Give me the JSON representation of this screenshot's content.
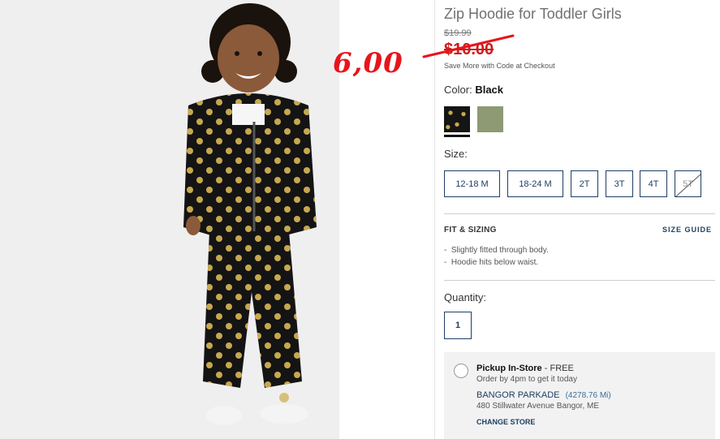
{
  "product": {
    "title": "Zip Hoodie for Toddler Girls",
    "price_was": "$19.99",
    "price_now": "$10.00",
    "promo_note": "Save More with Code at Checkout",
    "handwritten_price": "6,00"
  },
  "color": {
    "label": "Color:",
    "selected": "Black",
    "swatches": [
      {
        "name": "Black polka dot",
        "hex": "#151515"
      },
      {
        "name": "Olive",
        "hex": "#8d9a73"
      }
    ]
  },
  "size": {
    "label": "Size:",
    "options": [
      "12-18 M",
      "18-24 M",
      "2T",
      "3T",
      "4T",
      "5T"
    ],
    "unavailable": [
      "5T"
    ]
  },
  "fit": {
    "title": "FIT & SIZING",
    "guide_link": "SIZE GUIDE",
    "bullets": [
      "Slightly fitted through body.",
      "Hoodie hits below waist."
    ]
  },
  "quantity": {
    "label": "Quantity:",
    "value": "1"
  },
  "pickup": {
    "title": "Pickup In-Store",
    "fee": "- FREE",
    "subtitle": "Order by 4pm to get it today",
    "store_name": "BANGOR PARKADE",
    "store_distance": "(4278.76 Mi)",
    "store_address": "480 Stillwater Avenue Bangor, ME",
    "change_store": "CHANGE STORE"
  },
  "colors": {
    "accent": "#1f3e63",
    "sale_red": "#cc1b1b",
    "annotation_red": "#e8141b"
  }
}
